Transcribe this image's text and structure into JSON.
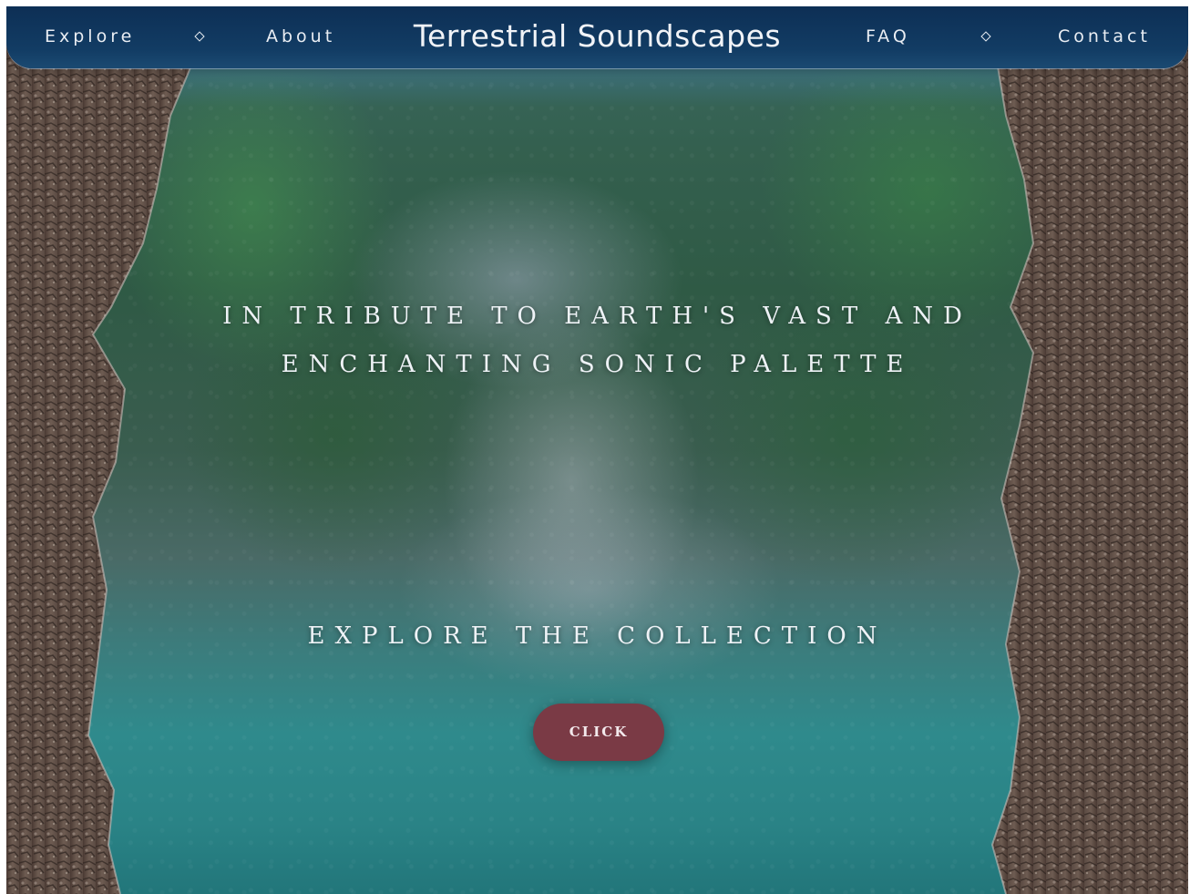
{
  "nav": {
    "left_links": [
      {
        "label": "Explore"
      },
      {
        "label": "About"
      }
    ],
    "site_title": "Terrestrial Soundscapes",
    "right_links": [
      {
        "label": "FAQ"
      },
      {
        "label": "Contact"
      }
    ],
    "separator_icon": "diamond-icon"
  },
  "hero": {
    "tagline_line1": "IN TRIBUTE TO EARTH'S VAST AND",
    "tagline_line2": "ENCHANTING SONIC PALETTE",
    "collection_heading": "EXPLORE THE COLLECTION",
    "cta_label": "CLICK"
  },
  "colors": {
    "nav_background": "#123c64",
    "cta_background": "#7a3a45",
    "text": "#eef2f6"
  },
  "background": {
    "scene": "blurred waterfall seen through rain-covered glass, framed by rock walls"
  }
}
